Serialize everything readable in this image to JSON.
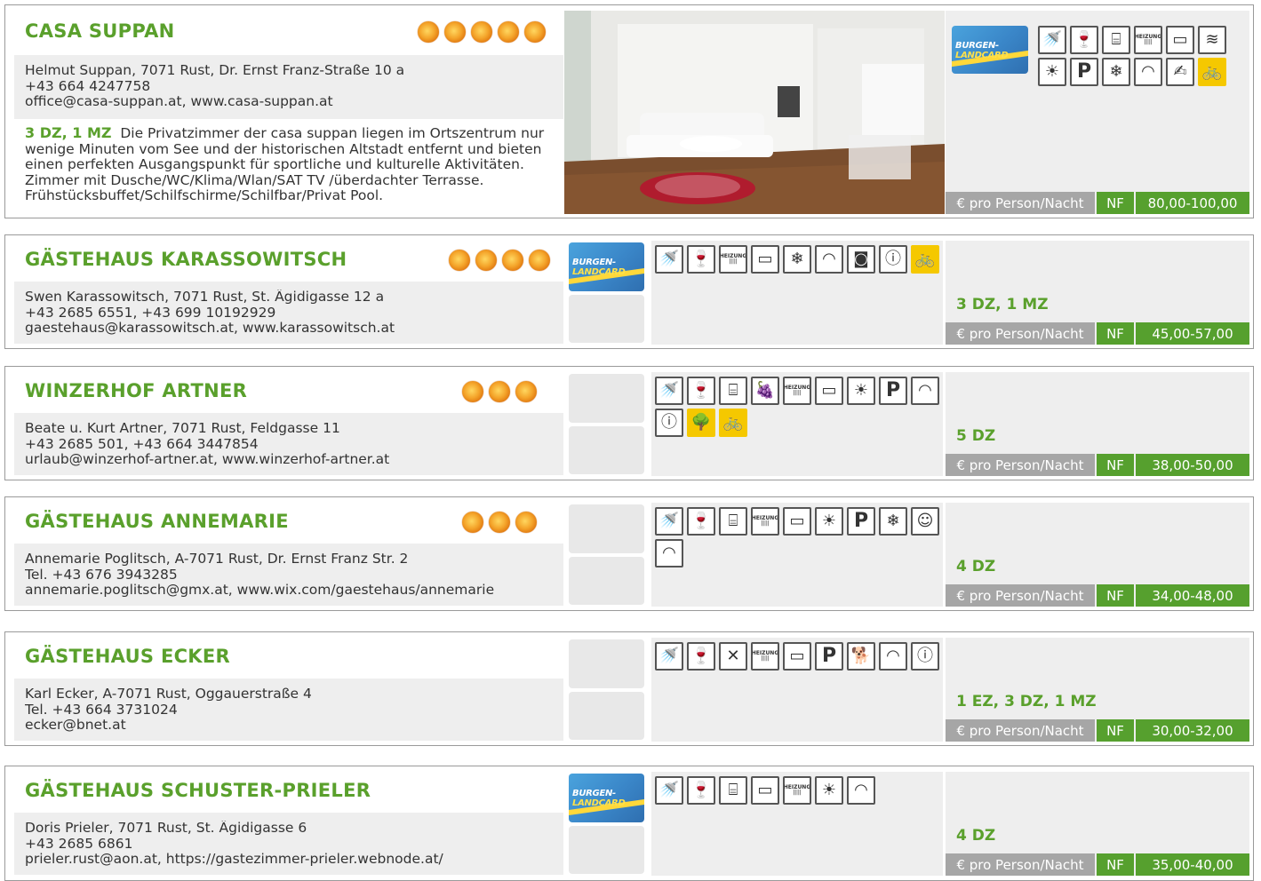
{
  "price_unit": "€ pro Person/Nacht",
  "price_code": "NF",
  "burgenland_card": {
    "line1": "BURGEN-",
    "line2": "LANDCARD"
  },
  "listings": [
    {
      "name": "CASA SUPPAN",
      "stars": 5,
      "contact": [
        "Helmut Suppan, 7071 Rust, Dr. Ernst Franz-Straße 10 a",
        "+43 664 4247758",
        "office@casa-suppan.at, www.casa-suppan.at"
      ],
      "rooms": "3 DZ, 1 MZ",
      "description": "Die Privatzimmer der casa suppan liegen im Ortszentrum nur wenige Minuten vom See und der historischen Altstadt entfernt und bieten einen perfekten Ausgangspunkt für sportliche und kulturelle Aktivitäten. Zimmer mit Dusche/WC/Klima/Wlan/SAT TV /überdachter Terrasse. Frühstücksbuffet/Schilfschirme/Schilfbar/Privat Pool.",
      "price": "80,00-100,00",
      "icons": [
        "shower-icon",
        "breakfast-icon",
        "fridge-icon",
        "heating-icon",
        "tv-icon",
        "pool-icon",
        "terrace-icon",
        "parking-icon",
        "air-conditioning-icon",
        "wifi-icon",
        "garden-icon",
        "bike-icon"
      ]
    },
    {
      "name": "GÄSTEHAUS KARASSOWITSCH",
      "stars": 4,
      "contact": [
        "Swen Karassowitsch, 7071 Rust, St. Ägidigasse 12 a",
        "+43 2685 6551, +43 699 10192929",
        "gaestehaus@karassowitsch.at, www.karassowitsch.at"
      ],
      "rooms": "3 DZ, 1 MZ",
      "price": "45,00-57,00",
      "icons": [
        "shower-icon",
        "breakfast-icon",
        "heating-icon",
        "tv-icon",
        "air-conditioning-icon",
        "wifi-icon",
        "safe-icon",
        "info-icon",
        "bike-icon"
      ]
    },
    {
      "name": "WINZERHOF ARTNER",
      "stars": 3,
      "contact": [
        "Beate u. Kurt Artner, 7071 Rust, Feldgasse 11",
        "+43 2685 501, +43 664 3447854",
        "urlaub@winzerhof-artner.at, www.winzerhof-artner.at"
      ],
      "rooms": "5 DZ",
      "price": "38,00-50,00",
      "icons": [
        "shower-icon",
        "breakfast-icon",
        "fridge-icon",
        "grapes-icon",
        "heating-icon",
        "tv-icon",
        "terrace-icon",
        "parking-icon",
        "wifi-icon",
        "info-icon",
        "nature-icon",
        "bike-icon"
      ]
    },
    {
      "name": "GÄSTEHAUS ANNEMARIE",
      "stars": 3,
      "contact": [
        "Annemarie Poglitsch, A-7071 Rust, Dr. Ernst Franz Str. 2",
        "Tel. +43 676 3943285",
        "annemarie.poglitsch@gmx.at, www.wix.com/gaestehaus/annemarie"
      ],
      "rooms": "4 DZ",
      "price": "34,00-48,00",
      "icons": [
        "shower-icon",
        "breakfast-icon",
        "fridge-icon",
        "heating-icon",
        "tv-icon",
        "terrace-icon",
        "parking-icon",
        "air-conditioning-icon",
        "child-icon",
        "wifi-icon"
      ]
    },
    {
      "name": "GÄSTEHAUS ECKER",
      "stars": 0,
      "contact": [
        "Karl Ecker, A-7071 Rust, Oggauerstraße 4",
        "Tel. +43 664 3731024",
        "ecker@bnet.at"
      ],
      "rooms": "1 EZ, 3 DZ, 1 MZ",
      "price": "30,00-32,00",
      "icons": [
        "shower-icon",
        "breakfast-icon",
        "restaurant-icon",
        "heating-icon",
        "tv-icon",
        "parking-icon",
        "pets-icon",
        "wifi-icon",
        "info-icon"
      ]
    },
    {
      "name": "GÄSTEHAUS SCHUSTER-PRIELER",
      "stars": 0,
      "contact": [
        "Doris Prieler, 7071 Rust, St. Ägidigasse 6",
        "+43 2685 6861",
        "prieler.rust@aon.at, https://gastezimmer-prieler.webnode.at/"
      ],
      "rooms": "4 DZ",
      "price": "35,00-40,00",
      "icons": [
        "shower-icon",
        "breakfast-icon",
        "fridge-icon",
        "tv-icon",
        "heating-icon",
        "terrace-icon",
        "wifi-icon"
      ]
    }
  ],
  "heating_label": "HEIZUNG",
  "parking_label": "P"
}
